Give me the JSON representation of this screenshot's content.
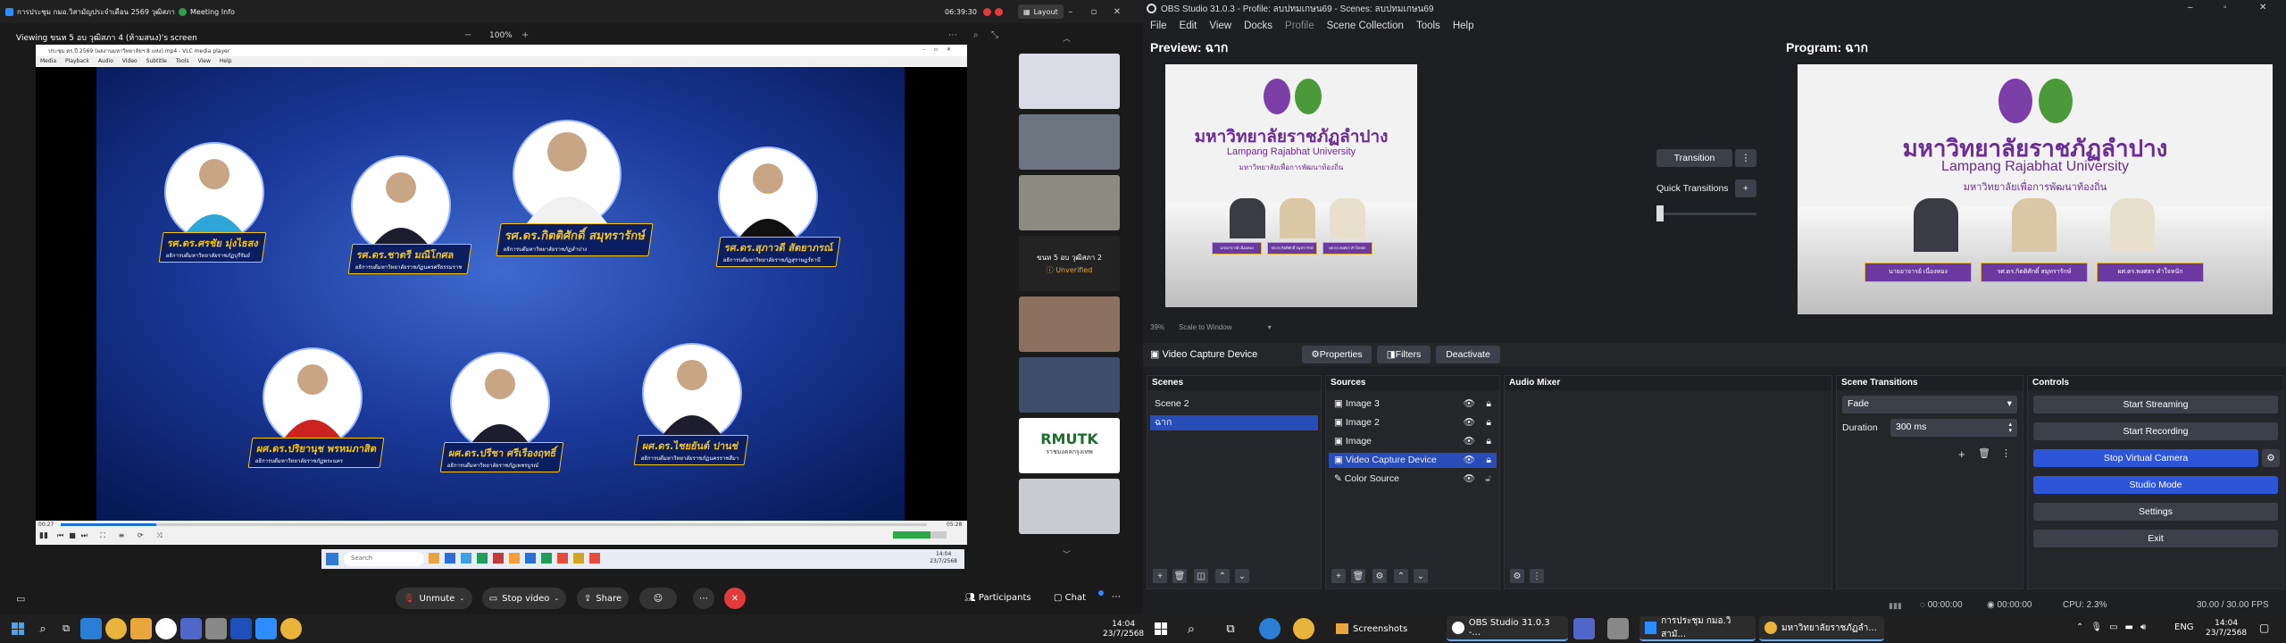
{
  "zoom": {
    "titlebar": {
      "meeting_title": "การประชุม กมอ.วิสามัญประจำเดือน 2569 วุฒิสภา",
      "meeting_info": "Meeting Info",
      "timer": "06:39:30",
      "layout": "Layout"
    },
    "subbar": {
      "viewing": "Viewing ขนห 5 อบ วุฒิสภา 4 (ห้ามสนง)'s screen",
      "zoom_level": "100%",
      "zoom_minus": "−",
      "zoom_plus": "+"
    },
    "vlc": {
      "title": "ประชุม ดร.ปี 2569 (ผลงานมหาวิทยาลัยฯ 8 แห่ง).mp4 - VLC media player",
      "menu": [
        "Media",
        "Playback",
        "Audio",
        "Video",
        "Subtitle",
        "Tools",
        "View",
        "Help"
      ],
      "time_elapsed": "00:27",
      "time_total": "05:28",
      "progress": 0.11
    },
    "speakers": [
      {
        "name": "รศ.ดร.ศรชัย มุ่งไธสง",
        "role": "อธิการบดีมหาวิทยาลัยราชภัฏบุรีรัมย์"
      },
      {
        "name": "รศ.ดร.ชาตรี มณีโกศล",
        "role": "อธิการบดีมหาวิทยาลัยราชภัฏนครศรีธรรมราช"
      },
      {
        "name": "รศ.ดร.กิตติศักดิ์ สมุทรารักษ์",
        "role": "อธิการบดีมหาวิทยาลัยราชภัฏลำปาง"
      },
      {
        "name": "รศ.ดร.สุภาวดี สัตยาภรณ์",
        "role": "อธิการบดีมหาวิทยาลัยราชภัฏสุราษฎร์ธานี"
      },
      {
        "name": "ผศ.ดร.ปริยานุช พรหมภาสิต",
        "role": "อธิการบดีมหาวิทยาลัยราชภัฏพระนคร"
      },
      {
        "name": "ผศ.ดร.ปรีชา ศรีเรืองฤทธิ์",
        "role": "อธิการบดีมหาวิทยาลัยราชภัฏเพชรบูรณ์"
      },
      {
        "name": "ผศ.ดร.ไชยยันต์ ปานช่",
        "role": "อธิการบดีมหาวิทยาลัยราชภัฏนครราชสีมา"
      }
    ],
    "inner_taskbar": {
      "search": "Search",
      "time": "14:04",
      "date": "23/7/2568"
    },
    "sidebar": {
      "participant_name": "ขนห 5 อบ วุฒิสภา 2",
      "unverified": "Unverified",
      "logo_text": "RMUTK",
      "logo_sub": "ราชมงคลกรุงเทพ"
    },
    "toolbar": {
      "unmute": "Unmute",
      "stop_video": "Stop video",
      "share": "Share",
      "participants": "Participants",
      "chat": "Chat"
    }
  },
  "obs": {
    "title": "OBS Studio 31.0.3 - Profile: ลบปทมเกษน69 - Scenes: ลบปทมเกษน69",
    "menu": [
      "File",
      "Edit",
      "View",
      "Docks",
      "Profile",
      "Scene Collection",
      "Tools",
      "Help"
    ],
    "preview_label": "Preview: ฉาก",
    "program_label": "Program: ฉาก",
    "stage": {
      "thai_name": "มหาวิทยาลัยราชภัฏลำปาง",
      "eng_name": "Lampang Rajabhat University",
      "tagline": "มหาวิทยาลัยเพื่อการพัฒนาท้องถิ่น",
      "name_cards": [
        "นายอาจารย์ เนื่องทอง",
        "รศ.ดร.กิตติศักดิ์ สมุทรารักษ์",
        "ผศ.ดร.พงศธร คำใจหนัก"
      ]
    },
    "zoom_pct": "39%",
    "scale_label": "Scale to Window",
    "transition_button": "Transition",
    "quick_transitions": "Quick Transitions",
    "source_bar": {
      "name": "Video Capture Device",
      "properties": "Properties",
      "filters": "Filters",
      "deactivate": "Deactivate"
    },
    "docks": {
      "scenes_title": "Scenes",
      "sources_title": "Sources",
      "mixer_title": "Audio Mixer",
      "transitions_title": "Scene Transitions",
      "controls_title": "Controls"
    },
    "scenes": [
      "Scene 2",
      "ฉาก"
    ],
    "sources": [
      "Image 3",
      "Image 2",
      "Image",
      "Video Capture Device",
      "Color Source"
    ],
    "transition": {
      "type": "Fade",
      "duration_label": "Duration",
      "duration": "300 ms"
    },
    "controls": [
      "Start Streaming",
      "Start Recording",
      "Stop Virtual Camera",
      "Studio Mode",
      "Settings",
      "Exit"
    ],
    "status": {
      "stream_time": "00:00:00",
      "rec_time": "00:00:00",
      "cpu": "CPU: 2.3%",
      "fps": "30.00 / 30.00 FPS"
    }
  },
  "taskbar": {
    "left_time": "14:04",
    "left_date": "23/7/2568",
    "apps": [
      {
        "label": "Screenshots"
      },
      {
        "label": "OBS Studio 31.0.3 -..."
      },
      {
        "label": "การประชุม กมอ.วิสามั..."
      },
      {
        "label": "มหาวิทยาลัยราชภัฏลำ..."
      }
    ],
    "lang": "ENG",
    "time": "14:04",
    "date": "23/7/2568"
  }
}
